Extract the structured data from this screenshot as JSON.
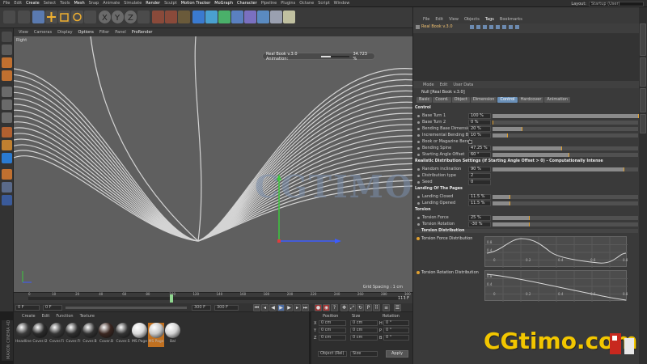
{
  "menu": [
    "File",
    "Edit",
    "Create",
    "Select",
    "Tools",
    "Mesh",
    "Snap",
    "Animate",
    "Simulate",
    "Render",
    "Sculpt",
    "Motion Tracker",
    "MoGraph",
    "Character",
    "Pipeline",
    "Plugins",
    "Octane",
    "Script",
    "Window"
  ],
  "layout": {
    "label": "Layout:",
    "value": "Startup (User)"
  },
  "viewport": {
    "menu": [
      "View",
      "Cameras",
      "Display",
      "Options",
      "Filter",
      "Panel",
      "ProRender"
    ],
    "label": "Right",
    "anim_label": "Real Book v.3.0 Animation:",
    "anim_value": "34.723 %",
    "anim_fraction": 0.347,
    "grid_spacing": "Grid Spacing : 1 cm",
    "watermark": "CGTIMO"
  },
  "timeline": {
    "ticks": [
      "0",
      "10",
      "20",
      "40",
      "60",
      "80",
      "100",
      "120",
      "140",
      "160",
      "180",
      "200",
      "220",
      "240",
      "260",
      "280",
      "300"
    ],
    "end_label": "113 F",
    "playhead_frame": 113
  },
  "transport": {
    "start": "0 F",
    "start2": "0 F",
    "end": "300 F",
    "end2": "300 F"
  },
  "materials": {
    "menu": [
      "Create",
      "Edit",
      "Function",
      "Texture"
    ],
    "items": [
      {
        "label": "Headline",
        "color": "#3a3a3a"
      },
      {
        "label": "Cover.l2",
        "color": "#2a2a2a"
      },
      {
        "label": "Cover.Fi",
        "color": "#353535"
      },
      {
        "label": "Cover.Fl",
        "color": "#2e2e2e"
      },
      {
        "label": "Cover.B",
        "color": "#303030"
      },
      {
        "label": "Cover.B",
        "color": "#3a2620"
      },
      {
        "label": "Cover.S",
        "color": "#333333"
      },
      {
        "label": "MS Page",
        "color": "#d9d9d9"
      },
      {
        "label": "MS Page",
        "color": "#c8c8c8"
      },
      {
        "label": "Bal",
        "color": "#d2d2d2"
      }
    ]
  },
  "coords": {
    "headers": [
      "Position",
      "Size",
      "Rotation"
    ],
    "rows": [
      {
        "axis": "X",
        "pos": "0 cm",
        "size": "0 cm",
        "rot_label": "H",
        "rot": "0 °"
      },
      {
        "axis": "Y",
        "pos": "0 cm",
        "size": "0 cm",
        "rot_label": "P",
        "rot": "0 °"
      },
      {
        "axis": "Z",
        "pos": "0 cm",
        "size": "0 cm",
        "rot_label": "B",
        "rot": "0 °"
      }
    ],
    "mode": "Object (Rel)",
    "size_mode": "Size",
    "apply": "Apply"
  },
  "objects": {
    "menu": [
      "File",
      "Edit",
      "View",
      "Objects",
      "Tags",
      "Bookmarks"
    ],
    "active_menu": "Tags",
    "name": "Real Book v.3.0"
  },
  "attributes": {
    "menu": [
      "Mode",
      "Edit",
      "User Data"
    ],
    "title": "Null [Real Book v.3.0]",
    "tabs": [
      "Basic",
      "Coord.",
      "Object",
      "Dimension",
      "Control",
      "Hardcover",
      "Animation"
    ],
    "active_tab": "Control",
    "control_title": "Control",
    "rows1": [
      {
        "label": "Base Turn 1",
        "value": "100 %",
        "fraction": 1.0
      },
      {
        "label": "Base Turn 2",
        "value": "0 %",
        "fraction": 0.0
      },
      {
        "label": "Bending Base Dimension",
        "value": "20 %",
        "fraction": 0.2
      },
      {
        "label": "Incremental Bending Base",
        "value": "10 %",
        "fraction": 0.1
      },
      {
        "label": "Book or Magazine Bend",
        "value": "",
        "fraction": null
      },
      {
        "label": "Bending Spine",
        "value": "47.25 %",
        "fraction": 0.4725
      },
      {
        "label": "Starting Angle Offset",
        "value": "60 °",
        "fraction": 0.52
      }
    ],
    "random_title": "Realistic Distribution Settings (if Starting Angle Offset > 0) - Computationally Intense",
    "rows2": [
      {
        "label": "Random inclination",
        "value": "90 %",
        "fraction": 0.9
      },
      {
        "label": "Distribution type",
        "value": "2",
        "fraction": null
      },
      {
        "label": "Seed",
        "value": "0",
        "fraction": null
      }
    ],
    "landing_title": "Landing Of The Pages",
    "rows3": [
      {
        "label": "Landing Closed",
        "value": "11.5 %",
        "fraction": 0.115
      },
      {
        "label": "Landing Opened",
        "value": "11.5 %",
        "fraction": 0.115
      }
    ],
    "torsion_title": "Torsion",
    "rows4": [
      {
        "label": "Torsion Force",
        "value": "25 %",
        "fraction": 0.25
      },
      {
        "label": "Torsion Rotation",
        "value": "-30 %",
        "fraction": 0.25
      }
    ],
    "torsion_dist_title": "Torsion Distribution",
    "graph1_label": "Torsion Force Distribution",
    "graph2_label": "Torsion Rotation Distribution",
    "graph_ticks_x": [
      "0",
      "0.2",
      "0.4",
      "0.6",
      "0.8"
    ],
    "graph_ticks_y": [
      "0.8",
      "0.4"
    ]
  },
  "brand": {
    "text": "CGtimo.com"
  },
  "maxon": {
    "text": "MAXON CINEMA 4D"
  },
  "colors": {
    "accent": "#f2c600",
    "tab_active": "#6a90b8",
    "axis_y": "#3cc83c",
    "axis_z": "#3c5cff",
    "axis_x": "#e03c3c"
  }
}
